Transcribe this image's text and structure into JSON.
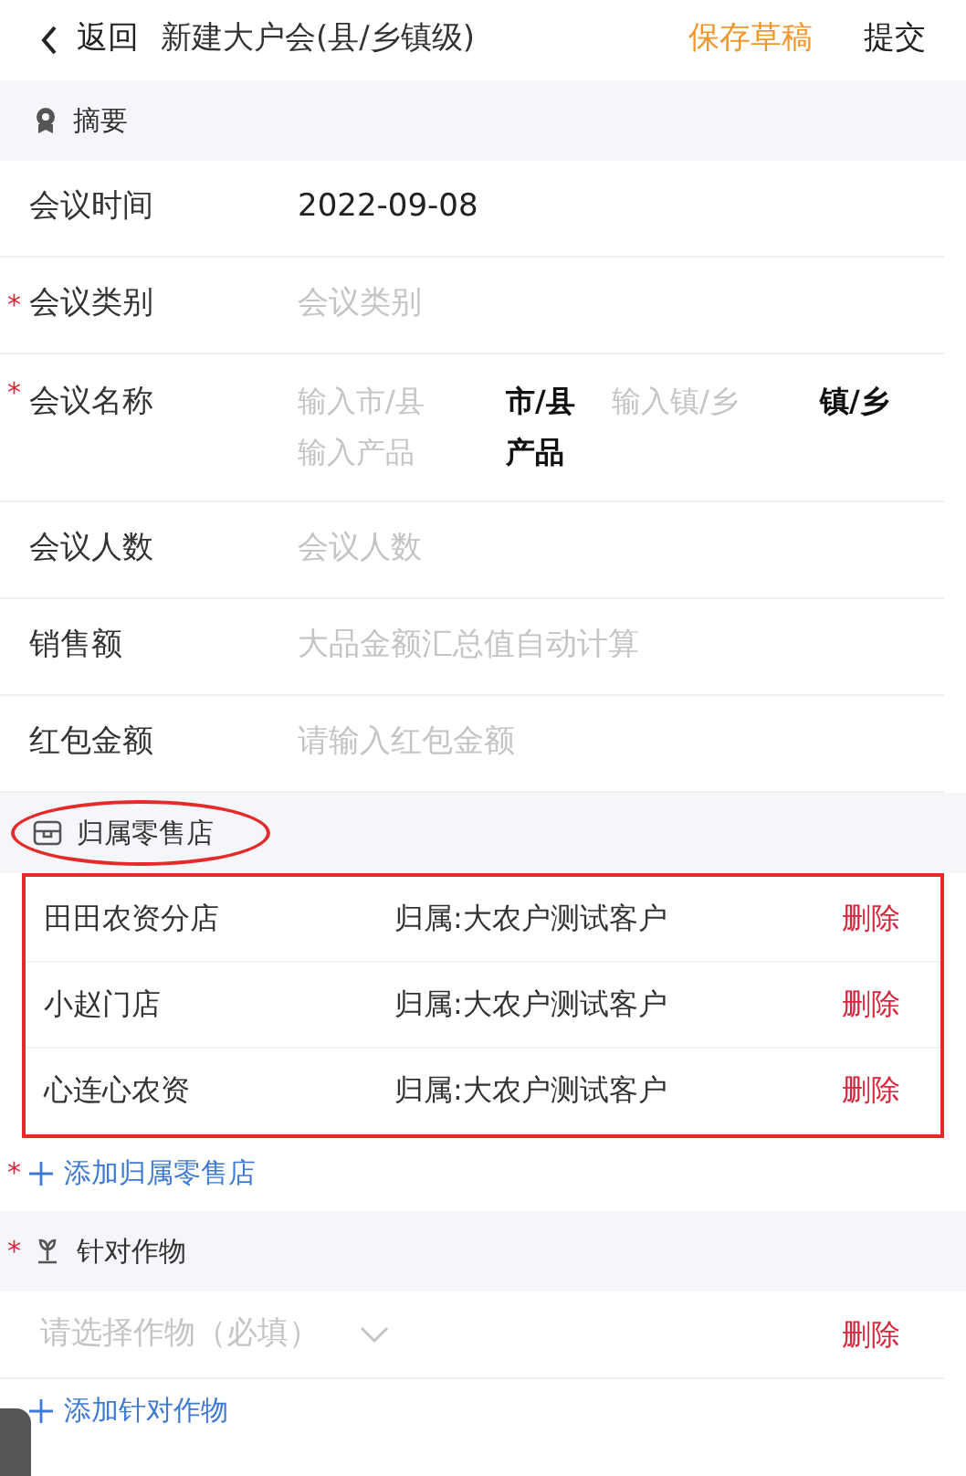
{
  "header": {
    "back": "返回",
    "title": "新建大户会(县/乡镇级)",
    "save_draft": "保存草稿",
    "submit": "提交"
  },
  "summary": {
    "title": "摘要",
    "fields": [
      {
        "kind": "value",
        "label": "会议时间",
        "value": "2022-09-08"
      },
      {
        "kind": "input",
        "label": "会议类别",
        "marker": "*",
        "placeholder": "会议类别"
      },
      {
        "kind": "name",
        "label": "会议名称",
        "marker": "*",
        "parts": [
          {
            "placeholder": "输入市/县",
            "suffix": "市/县"
          },
          {
            "placeholder": "输入镇/乡",
            "suffix": "镇/乡"
          },
          {
            "placeholder": "输入产品",
            "suffix": "产品"
          }
        ]
      },
      {
        "kind": "input",
        "label": "会议人数",
        "placeholder": "会议人数"
      },
      {
        "kind": "input",
        "label": "销售额",
        "placeholder": "大品金额汇总值自动计算"
      },
      {
        "kind": "input",
        "label": "红包金额",
        "placeholder": "请输入红包金额"
      }
    ]
  },
  "stores": {
    "title": "归属零售店",
    "circled": true,
    "boxed": true,
    "items": [
      {
        "name": "田田农资分店",
        "owner": "归属:大农户测试客户",
        "delete": "删除"
      },
      {
        "name": "小赵门店",
        "owner": "归属:大农户测试客户",
        "delete": "删除"
      },
      {
        "name": "心连心农资",
        "owner": "归属:大农户测试客户",
        "delete": "删除"
      }
    ],
    "add": {
      "marker": "*",
      "label": "添加归属零售店"
    }
  },
  "crops": {
    "title": "针对作物",
    "marker": "*",
    "items": [
      {
        "placeholder": "请选择作物（必填）",
        "delete": "删除"
      }
    ],
    "add": {
      "label": "添加针对作物"
    }
  }
}
